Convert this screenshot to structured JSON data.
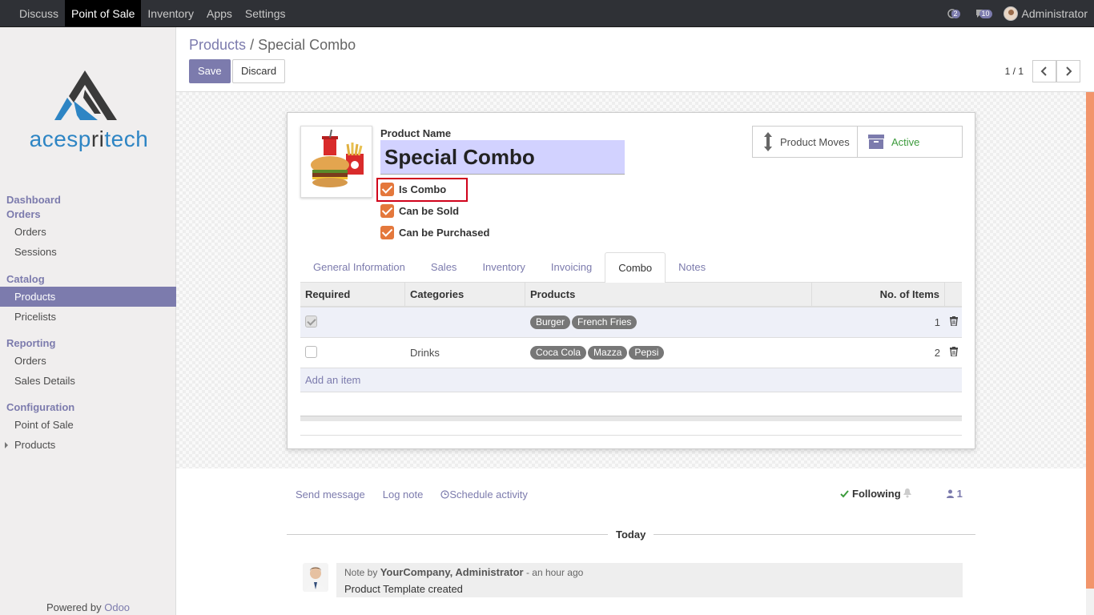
{
  "topbar": {
    "menu": [
      "Discuss",
      "Point of Sale",
      "Inventory",
      "Apps",
      "Settings"
    ],
    "active_index": 1,
    "activity_count": "2",
    "message_count": "10",
    "user_name": "Administrator"
  },
  "sidebar": {
    "logo_text_blue": "acesp",
    "logo_text_dark": "ri",
    "logo_text_blue2": "tech",
    "sections": [
      {
        "heading": "Dashboard"
      },
      {
        "heading": "Orders",
        "items": [
          "Orders",
          "Sessions"
        ]
      },
      {
        "heading": "Catalog",
        "items": [
          "Products",
          "Pricelists"
        ]
      },
      {
        "heading": "Reporting",
        "items": [
          "Orders",
          "Sales Details"
        ]
      },
      {
        "heading": "Configuration",
        "items": [
          "Point of Sale",
          "Products"
        ]
      }
    ],
    "powered_by": "Powered by",
    "powered_brand": "Odoo"
  },
  "control": {
    "breadcrumb_parent": "Products",
    "breadcrumb_sep": "/",
    "breadcrumb_current": "Special Combo",
    "save_label": "Save",
    "discard_label": "Discard",
    "pager": "1 / 1"
  },
  "form": {
    "product_name_label": "Product Name",
    "product_name": "Special Combo",
    "checkboxes": {
      "is_combo": "Is Combo",
      "can_be_sold": "Can be Sold",
      "can_be_purchased": "Can be Purchased"
    },
    "smart_buttons": {
      "moves": "Product Moves",
      "active": "Active"
    },
    "tabs": [
      "General Information",
      "Sales",
      "Inventory",
      "Invoicing",
      "Combo",
      "Notes"
    ],
    "active_tab": 4,
    "table": {
      "headers": [
        "Required",
        "Categories",
        "Products",
        "No. of Items"
      ],
      "rows": [
        {
          "required": true,
          "category": "",
          "products": [
            "Burger",
            "French Fries"
          ],
          "items": "1"
        },
        {
          "required": false,
          "category": "Drinks",
          "products": [
            "Coca Cola",
            "Mazza",
            "Pepsi"
          ],
          "items": "2"
        }
      ],
      "add_item": "Add an item"
    }
  },
  "chatter": {
    "send_message": "Send message",
    "log_note": "Log note",
    "schedule_activity": "Schedule activity",
    "following": "Following",
    "followers_count": "1",
    "date_separator": "Today",
    "message": {
      "prefix": "Note by",
      "author": "YourCompany, Administrator",
      "time": "- an hour ago",
      "body": "Product Template created"
    }
  },
  "colors": {
    "accent": "#7c7bad",
    "checkbox": "#e4783c",
    "highlight_border": "#d0021b",
    "active_green": "#3c9b3c"
  }
}
